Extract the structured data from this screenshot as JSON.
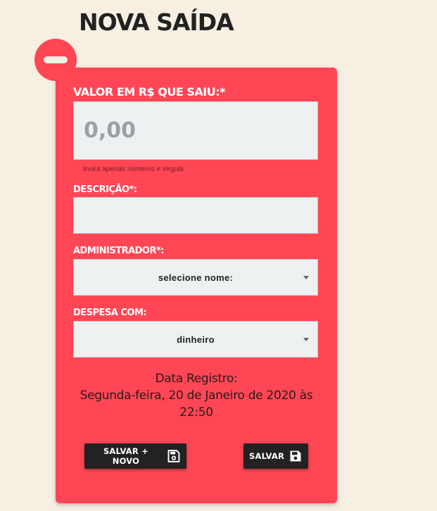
{
  "page": {
    "title": "NOVA SAÍDA"
  },
  "form": {
    "valor": {
      "label": "VALOR EM R$ QUE SAIU:*",
      "placeholder": "0,00",
      "value": "",
      "hint": "Insira apenas números e vírgula"
    },
    "descricao": {
      "label": "DESCRIÇÃO*:",
      "value": ""
    },
    "administrador": {
      "label": "ADMINISTRADOR*:",
      "selected": "selecione nome:"
    },
    "despesa": {
      "label": "DESPESA COM:",
      "selected": "dinheiro"
    },
    "data_registro": {
      "label": "Data Registro:",
      "value": "Segunda-feira, 20 de Janeiro de 2020 às 22:50"
    }
  },
  "buttons": {
    "salvar_novo": {
      "label": "SALVAR + NOVO",
      "icon": "save-outline-icon"
    },
    "salvar": {
      "label": "SALVAR",
      "icon": "save-icon"
    }
  },
  "colors": {
    "background": "#f6efe2",
    "card": "#ff4655",
    "button": "#222222",
    "field": "#edf1f2"
  }
}
